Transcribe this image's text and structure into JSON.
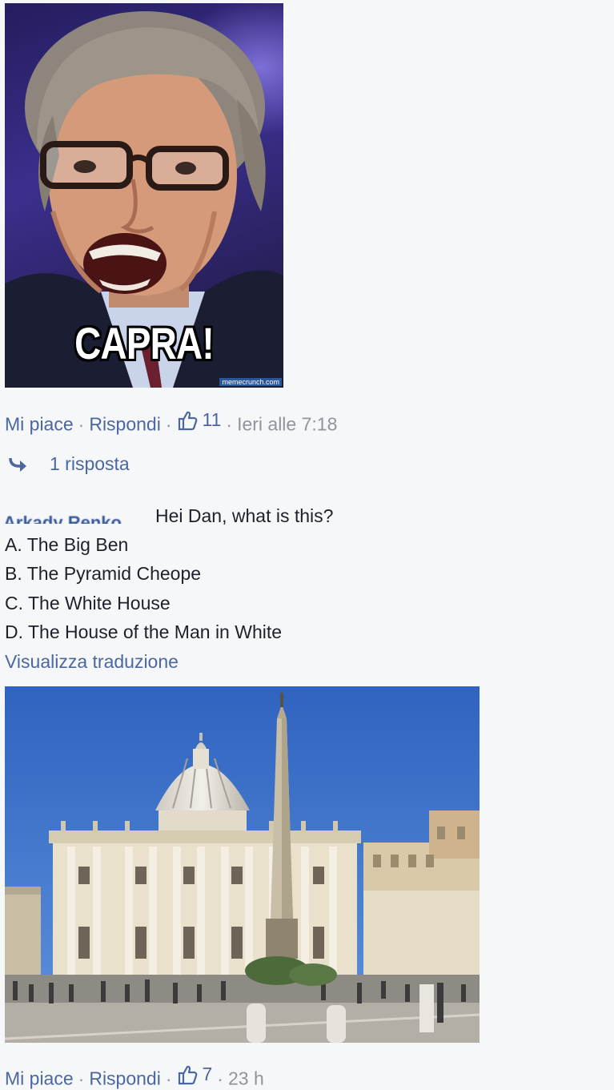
{
  "meme": {
    "caption": "CAPRA!",
    "watermark": "memecrunch.com"
  },
  "comment1_actions": {
    "like": "Mi piace",
    "separator": "·",
    "reply": "Rispondi",
    "like_icon": "thumbs-up-icon",
    "like_count": "11",
    "time": "Ieri alle 7:18"
  },
  "replies_link": {
    "icon": "reply-arrow-icon",
    "label": "1 risposta"
  },
  "comment2": {
    "author": "Arkady Renko",
    "first_line": "Hei Dan, what is this?",
    "options": [
      "A. The Big Ben",
      "B. The Pyramid Cheope",
      "C. The White House",
      "D. The House of the Man in White"
    ],
    "translate": "Visualizza traduzione"
  },
  "comment2_actions": {
    "like": "Mi piace",
    "separator": "·",
    "reply": "Rispondi",
    "like_icon": "thumbs-up-icon",
    "like_count": "7",
    "time": "23 h"
  },
  "colors": {
    "link": "#4b67a1",
    "meta": "#90949c",
    "text": "#1d2129",
    "background": "#f6f7f9",
    "sky": "#3a70c8"
  }
}
